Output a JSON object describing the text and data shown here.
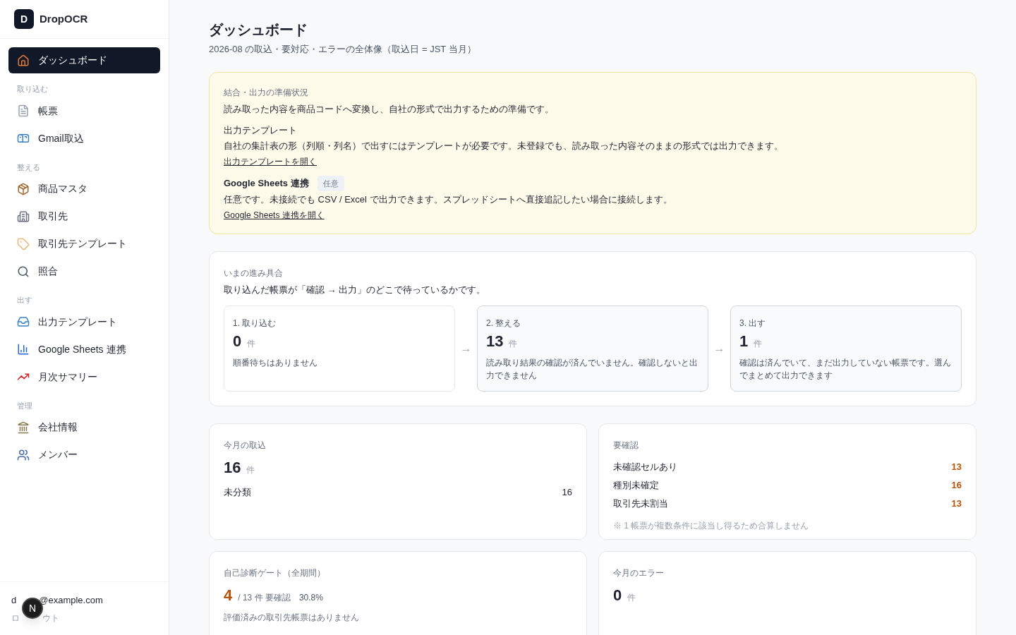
{
  "brand": {
    "logo": "D",
    "name": "DropOCR"
  },
  "nav": [
    {
      "kind": "item",
      "label": "ダッシュボード",
      "selected": true
    },
    {
      "kind": "section",
      "label": "取り込む"
    },
    {
      "kind": "item",
      "label": "帳票",
      "selected": false
    },
    {
      "kind": "item",
      "label": "Gmail取込",
      "selected": false
    },
    {
      "kind": "section",
      "label": "整える"
    },
    {
      "kind": "item",
      "label": "商品マスタ",
      "selected": false
    },
    {
      "kind": "item",
      "label": "取引先",
      "selected": false
    },
    {
      "kind": "item",
      "label": "取引先テンプレート",
      "selected": false
    },
    {
      "kind": "item",
      "label": "照合",
      "selected": false
    },
    {
      "kind": "section",
      "label": "出す"
    },
    {
      "kind": "item",
      "label": "出力テンプレート",
      "selected": false
    },
    {
      "kind": "item",
      "label": "Google Sheets 連携",
      "selected": false
    },
    {
      "kind": "item",
      "label": "月次サマリー",
      "selected": false
    },
    {
      "kind": "section",
      "label": "管理"
    },
    {
      "kind": "item",
      "label": "会社情報",
      "selected": false
    },
    {
      "kind": "item",
      "label": "メンバー",
      "selected": false
    }
  ],
  "user": {
    "email_start": "d",
    "email_end": "@example.com",
    "logout_start": "ロ",
    "logout_end": "ウト",
    "overlay_badge": "N"
  },
  "page": {
    "title": "ダッシュボード",
    "subtitle": "2026-08 の取込・要対応・エラーの全体像（取込日 = JST 当月）"
  },
  "readiness": {
    "label": "結合・出力の準備状況",
    "intro": "読み取った内容を商品コードへ変換し、自社の形式で出力するための準備です。",
    "items": [
      {
        "title": "出力テンプレート",
        "text": "自社の集計表の形（列順・列名）で出すにはテンプレートが必要です。未登録でも、読み取った内容そのままの形式では出力できます。",
        "link": "出力テンプレートを開く"
      },
      {
        "title": "Google Sheets 連携",
        "badge": "任意",
        "text": "任意です。未接続でも CSV / Excel で出力できます。スプレッドシートへ直接追記したい場合に接続します。",
        "link": "Google Sheets 連携を開く"
      }
    ]
  },
  "progress": {
    "label": "いまの進み具合",
    "intro": "取り込んだ帳票が「確認 → 出力」のどこで待っているかです。",
    "arrow": "→",
    "stages": [
      {
        "title": "1. 取り込む",
        "count": "0",
        "unit": "件",
        "text": "順番待ちはありません",
        "active": false
      },
      {
        "title": "2. 整える",
        "count": "13",
        "unit": "件",
        "text": "読み取り結果の確認が済んでいません。確認しないと出力できません",
        "active": true
      },
      {
        "title": "3. 出す",
        "count": "1",
        "unit": "件",
        "text": "確認は済んでいて、まだ出力していない帳票です。選んでまとめて出力できます",
        "active": true
      }
    ]
  },
  "imports": {
    "label": "今月の取込",
    "count": "16",
    "unit": "件",
    "rows": [
      {
        "label": "未分類",
        "value": "16"
      }
    ]
  },
  "review": {
    "label": "要確認",
    "rows": [
      {
        "label": "未確認セルあり",
        "value": "13"
      },
      {
        "label": "種別未確定",
        "value": "16"
      },
      {
        "label": "取引先未割当",
        "value": "13"
      }
    ],
    "note": "※ 1 帳票が複数条件に該当し得るため合算しません"
  },
  "diagnosis": {
    "label": "自己診断ゲート（全期間）",
    "count": "4",
    "total": "/ 13 件 要確認",
    "rate": "30.8%",
    "note": "評価済みの取引先帳票はありません"
  },
  "errors": {
    "label": "今月のエラー",
    "count": "0",
    "unit": "件"
  }
}
